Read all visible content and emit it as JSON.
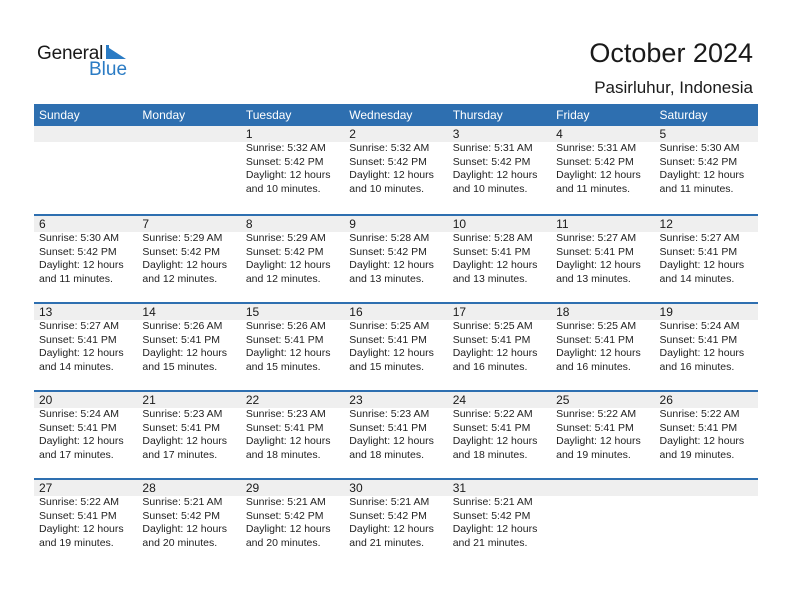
{
  "logo": {
    "word1": "General",
    "word2": "Blue",
    "icon": "triangle-flag-icon",
    "brand_color": "#2a7bc4"
  },
  "header": {
    "title": "October 2024",
    "location": "Pasirluhur, Indonesia"
  },
  "colors": {
    "header_bg": "#2e6fb0",
    "date_band": "#efefef"
  },
  "weekdays": [
    "Sunday",
    "Monday",
    "Tuesday",
    "Wednesday",
    "Thursday",
    "Friday",
    "Saturday"
  ],
  "weeks": [
    [
      null,
      null,
      {
        "day": "1",
        "sunrise": "Sunrise: 5:32 AM",
        "sunset": "Sunset: 5:42 PM",
        "daylight1": "Daylight: 12 hours",
        "daylight2": "and 10 minutes."
      },
      {
        "day": "2",
        "sunrise": "Sunrise: 5:32 AM",
        "sunset": "Sunset: 5:42 PM",
        "daylight1": "Daylight: 12 hours",
        "daylight2": "and 10 minutes."
      },
      {
        "day": "3",
        "sunrise": "Sunrise: 5:31 AM",
        "sunset": "Sunset: 5:42 PM",
        "daylight1": "Daylight: 12 hours",
        "daylight2": "and 10 minutes."
      },
      {
        "day": "4",
        "sunrise": "Sunrise: 5:31 AM",
        "sunset": "Sunset: 5:42 PM",
        "daylight1": "Daylight: 12 hours",
        "daylight2": "and 11 minutes."
      },
      {
        "day": "5",
        "sunrise": "Sunrise: 5:30 AM",
        "sunset": "Sunset: 5:42 PM",
        "daylight1": "Daylight: 12 hours",
        "daylight2": "and 11 minutes."
      }
    ],
    [
      {
        "day": "6",
        "sunrise": "Sunrise: 5:30 AM",
        "sunset": "Sunset: 5:42 PM",
        "daylight1": "Daylight: 12 hours",
        "daylight2": "and 11 minutes."
      },
      {
        "day": "7",
        "sunrise": "Sunrise: 5:29 AM",
        "sunset": "Sunset: 5:42 PM",
        "daylight1": "Daylight: 12 hours",
        "daylight2": "and 12 minutes."
      },
      {
        "day": "8",
        "sunrise": "Sunrise: 5:29 AM",
        "sunset": "Sunset: 5:42 PM",
        "daylight1": "Daylight: 12 hours",
        "daylight2": "and 12 minutes."
      },
      {
        "day": "9",
        "sunrise": "Sunrise: 5:28 AM",
        "sunset": "Sunset: 5:42 PM",
        "daylight1": "Daylight: 12 hours",
        "daylight2": "and 13 minutes."
      },
      {
        "day": "10",
        "sunrise": "Sunrise: 5:28 AM",
        "sunset": "Sunset: 5:41 PM",
        "daylight1": "Daylight: 12 hours",
        "daylight2": "and 13 minutes."
      },
      {
        "day": "11",
        "sunrise": "Sunrise: 5:27 AM",
        "sunset": "Sunset: 5:41 PM",
        "daylight1": "Daylight: 12 hours",
        "daylight2": "and 13 minutes."
      },
      {
        "day": "12",
        "sunrise": "Sunrise: 5:27 AM",
        "sunset": "Sunset: 5:41 PM",
        "daylight1": "Daylight: 12 hours",
        "daylight2": "and 14 minutes."
      }
    ],
    [
      {
        "day": "13",
        "sunrise": "Sunrise: 5:27 AM",
        "sunset": "Sunset: 5:41 PM",
        "daylight1": "Daylight: 12 hours",
        "daylight2": "and 14 minutes."
      },
      {
        "day": "14",
        "sunrise": "Sunrise: 5:26 AM",
        "sunset": "Sunset: 5:41 PM",
        "daylight1": "Daylight: 12 hours",
        "daylight2": "and 15 minutes."
      },
      {
        "day": "15",
        "sunrise": "Sunrise: 5:26 AM",
        "sunset": "Sunset: 5:41 PM",
        "daylight1": "Daylight: 12 hours",
        "daylight2": "and 15 minutes."
      },
      {
        "day": "16",
        "sunrise": "Sunrise: 5:25 AM",
        "sunset": "Sunset: 5:41 PM",
        "daylight1": "Daylight: 12 hours",
        "daylight2": "and 15 minutes."
      },
      {
        "day": "17",
        "sunrise": "Sunrise: 5:25 AM",
        "sunset": "Sunset: 5:41 PM",
        "daylight1": "Daylight: 12 hours",
        "daylight2": "and 16 minutes."
      },
      {
        "day": "18",
        "sunrise": "Sunrise: 5:25 AM",
        "sunset": "Sunset: 5:41 PM",
        "daylight1": "Daylight: 12 hours",
        "daylight2": "and 16 minutes."
      },
      {
        "day": "19",
        "sunrise": "Sunrise: 5:24 AM",
        "sunset": "Sunset: 5:41 PM",
        "daylight1": "Daylight: 12 hours",
        "daylight2": "and 16 minutes."
      }
    ],
    [
      {
        "day": "20",
        "sunrise": "Sunrise: 5:24 AM",
        "sunset": "Sunset: 5:41 PM",
        "daylight1": "Daylight: 12 hours",
        "daylight2": "and 17 minutes."
      },
      {
        "day": "21",
        "sunrise": "Sunrise: 5:23 AM",
        "sunset": "Sunset: 5:41 PM",
        "daylight1": "Daylight: 12 hours",
        "daylight2": "and 17 minutes."
      },
      {
        "day": "22",
        "sunrise": "Sunrise: 5:23 AM",
        "sunset": "Sunset: 5:41 PM",
        "daylight1": "Daylight: 12 hours",
        "daylight2": "and 18 minutes."
      },
      {
        "day": "23",
        "sunrise": "Sunrise: 5:23 AM",
        "sunset": "Sunset: 5:41 PM",
        "daylight1": "Daylight: 12 hours",
        "daylight2": "and 18 minutes."
      },
      {
        "day": "24",
        "sunrise": "Sunrise: 5:22 AM",
        "sunset": "Sunset: 5:41 PM",
        "daylight1": "Daylight: 12 hours",
        "daylight2": "and 18 minutes."
      },
      {
        "day": "25",
        "sunrise": "Sunrise: 5:22 AM",
        "sunset": "Sunset: 5:41 PM",
        "daylight1": "Daylight: 12 hours",
        "daylight2": "and 19 minutes."
      },
      {
        "day": "26",
        "sunrise": "Sunrise: 5:22 AM",
        "sunset": "Sunset: 5:41 PM",
        "daylight1": "Daylight: 12 hours",
        "daylight2": "and 19 minutes."
      }
    ],
    [
      {
        "day": "27",
        "sunrise": "Sunrise: 5:22 AM",
        "sunset": "Sunset: 5:41 PM",
        "daylight1": "Daylight: 12 hours",
        "daylight2": "and 19 minutes."
      },
      {
        "day": "28",
        "sunrise": "Sunrise: 5:21 AM",
        "sunset": "Sunset: 5:42 PM",
        "daylight1": "Daylight: 12 hours",
        "daylight2": "and 20 minutes."
      },
      {
        "day": "29",
        "sunrise": "Sunrise: 5:21 AM",
        "sunset": "Sunset: 5:42 PM",
        "daylight1": "Daylight: 12 hours",
        "daylight2": "and 20 minutes."
      },
      {
        "day": "30",
        "sunrise": "Sunrise: 5:21 AM",
        "sunset": "Sunset: 5:42 PM",
        "daylight1": "Daylight: 12 hours",
        "daylight2": "and 21 minutes."
      },
      {
        "day": "31",
        "sunrise": "Sunrise: 5:21 AM",
        "sunset": "Sunset: 5:42 PM",
        "daylight1": "Daylight: 12 hours",
        "daylight2": "and 21 minutes."
      },
      null,
      null
    ]
  ]
}
